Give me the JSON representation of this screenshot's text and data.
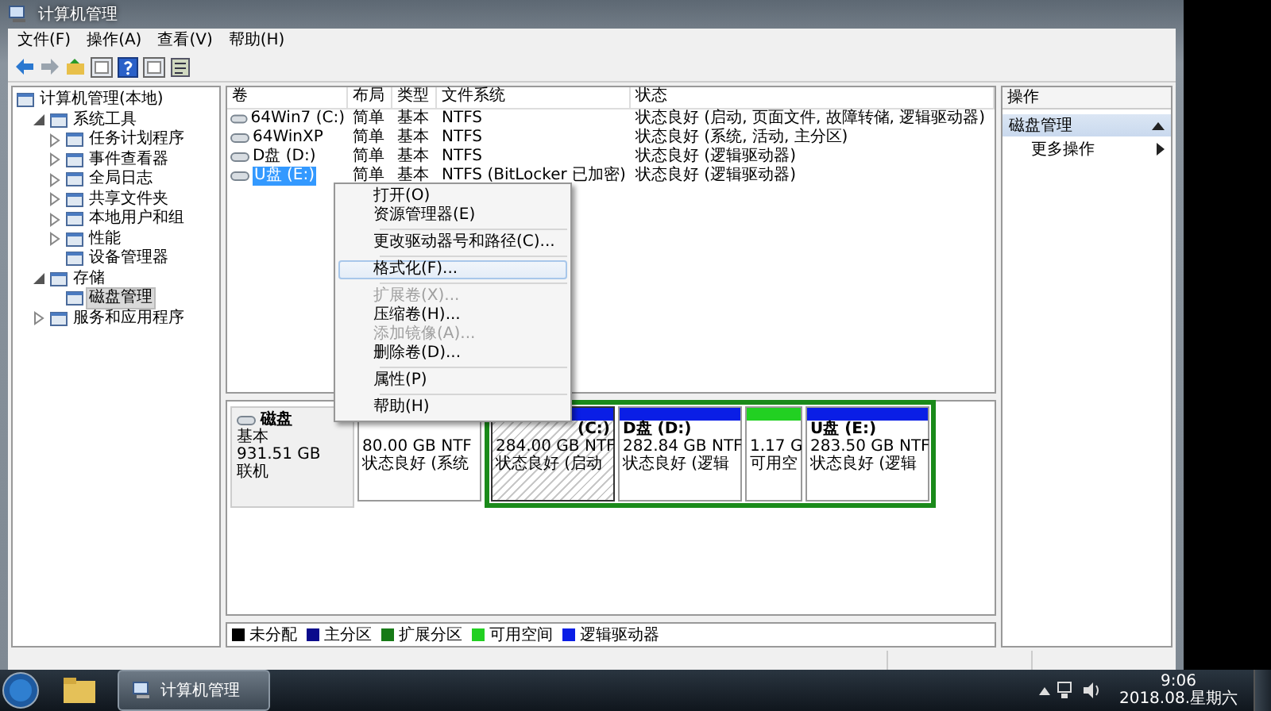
{
  "window": {
    "title": "计算机管理"
  },
  "menubar": [
    "文件(F)",
    "操作(A)",
    "查看(V)",
    "帮助(H)"
  ],
  "tree": [
    {
      "label": "计算机管理(本地)",
      "selected": false,
      "children": [
        {
          "label": "系统工具",
          "expanded": true,
          "selected": false,
          "children": [
            {
              "label": "任务计划程序",
              "expanded": false,
              "selected": false
            },
            {
              "label": "事件查看器",
              "expanded": false,
              "selected": false
            },
            {
              "label": "全局日志",
              "expanded": false,
              "selected": false
            },
            {
              "label": "共享文件夹",
              "expanded": false,
              "selected": false
            },
            {
              "label": "本地用户和组",
              "expanded": false,
              "selected": false
            },
            {
              "label": "性能",
              "expanded": false,
              "selected": false
            },
            {
              "label": "设备管理器",
              "selected": false
            }
          ]
        },
        {
          "label": "存储",
          "expanded": true,
          "selected": false,
          "children": [
            {
              "label": "磁盘管理",
              "selected": true
            }
          ]
        },
        {
          "label": "服务和应用程序",
          "expanded": false,
          "selected": false
        }
      ]
    }
  ],
  "volumes": {
    "columns": [
      "卷",
      "布局",
      "类型",
      "文件系统",
      "状态"
    ],
    "rows": [
      {
        "name": "64Win7  (C:)",
        "layout": "简单",
        "type": "基本",
        "fs": "NTFS",
        "status": "状态良好 (启动, 页面文件, 故障转储, 逻辑驱动器)",
        "selected": false
      },
      {
        "name": "64WinXP",
        "layout": "简单",
        "type": "基本",
        "fs": "NTFS",
        "status": "状态良好 (系统, 活动, 主分区)",
        "selected": false
      },
      {
        "name": "D盘 (D:)",
        "layout": "简单",
        "type": "基本",
        "fs": "NTFS",
        "status": "状态良好 (逻辑驱动器)",
        "selected": false
      },
      {
        "name": "U盘 (E:)",
        "layout": "简单",
        "type": "基本",
        "fs": "NTFS (BitLocker 已加密)",
        "status": "状态良好 (逻辑驱动器)",
        "selected": true
      }
    ]
  },
  "context_menu": {
    "groups": [
      [
        {
          "label": "打开(O)",
          "disabled": false,
          "selected": false
        },
        {
          "label": "资源管理器(E)",
          "disabled": false,
          "selected": false
        }
      ],
      [
        {
          "label": "更改驱动器号和路径(C)...",
          "disabled": false,
          "selected": false
        }
      ],
      [
        {
          "label": "格式化(F)...",
          "disabled": false,
          "selected": true
        }
      ],
      [
        {
          "label": "扩展卷(X)...",
          "disabled": true,
          "selected": false
        },
        {
          "label": "压缩卷(H)...",
          "disabled": false,
          "selected": false
        },
        {
          "label": "添加镜像(A)...",
          "disabled": true,
          "selected": false
        },
        {
          "label": "删除卷(D)...",
          "disabled": false,
          "selected": false
        }
      ],
      [
        {
          "label": "属性(P)",
          "disabled": false,
          "selected": false
        }
      ],
      [
        {
          "label": "帮助(H)",
          "disabled": false,
          "selected": false
        }
      ]
    ]
  },
  "disk": {
    "name": "磁盘",
    "type": "基本",
    "size": "931.51 GB",
    "state": "联机",
    "partitions": [
      {
        "size": "80.00 GB NTF",
        "status": "状态良好 (系统",
        "selected": false
      }
    ],
    "extended_partitions": [
      {
        "name": "(C:)",
        "size": "284.00 GB NTF",
        "status": "状态良好 (启动",
        "color": "#0a1ee6",
        "selected": true
      },
      {
        "name": "D盘  (D:)",
        "size": "282.84 GB NTF",
        "status": "状态良好 (逻辑",
        "color": "#0a1ee6",
        "selected": false
      },
      {
        "size": "1.17 G",
        "status": "可用空",
        "color": "#22d022",
        "selected": false
      },
      {
        "name": "U盘  (E:)",
        "size": "283.50 GB NTF",
        "status": "状态良好 (逻辑",
        "color": "#0a1ee6",
        "selected": false
      }
    ]
  },
  "legend": [
    {
      "label": "未分配",
      "color": "#000000"
    },
    {
      "label": "主分区",
      "color": "#0a0a8c"
    },
    {
      "label": "扩展分区",
      "color": "#177a17"
    },
    {
      "label": "可用空间",
      "color": "#22d022"
    },
    {
      "label": "逻辑驱动器",
      "color": "#0a1ee6"
    }
  ],
  "actions": {
    "header": "操作",
    "sections": [
      {
        "title": "磁盘管理",
        "expanded": true,
        "items": [
          "更多操作"
        ]
      }
    ]
  },
  "taskbar": {
    "apps": [
      {
        "label": "计算机管理",
        "selected": true
      }
    ],
    "time": "9:06",
    "date": "2018.08.星期六"
  }
}
